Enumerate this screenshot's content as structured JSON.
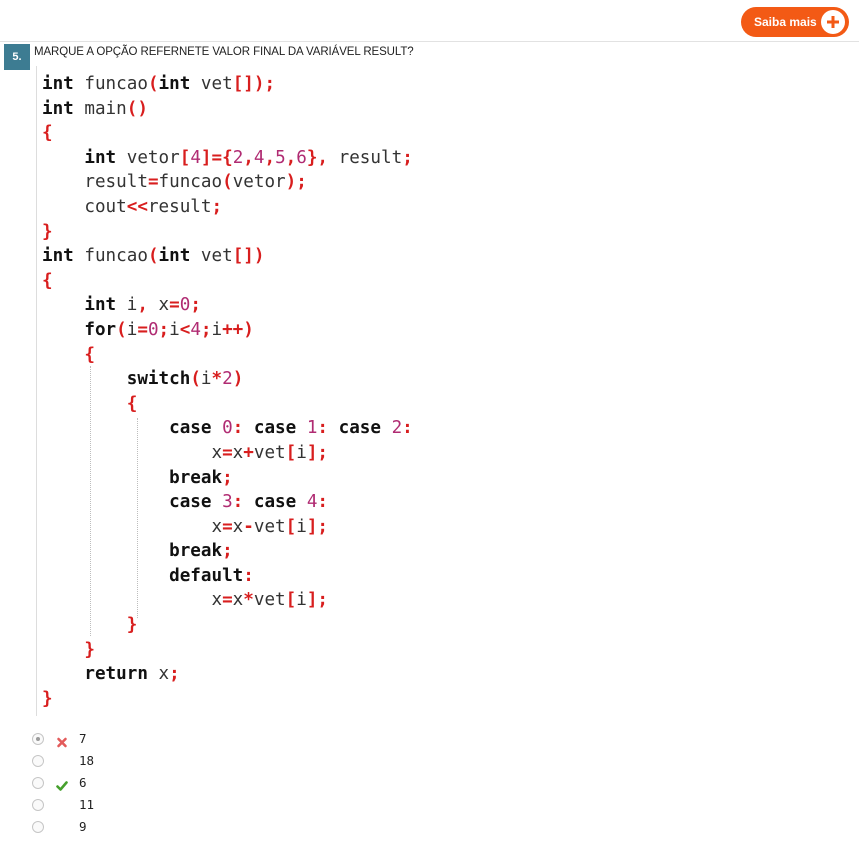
{
  "header": {
    "saiba_mais_label": "Saiba mais",
    "accent_color": "#f35a15",
    "icon": "plus-circle-icon"
  },
  "question": {
    "number": "5.",
    "text": "MARQUE A OPÇÃO REFERNETE VALOR FINAL DA VARIÁVEL RESULT?",
    "code_lines": [
      "int funcao(int vet[]);",
      "int main()",
      "{",
      "    int vetor[4]={2,4,5,6}, result;",
      "    result=funcao(vetor);",
      "    cout<<result;",
      "}",
      "int funcao(int vet[])",
      "{",
      "    int i, x=0;",
      "    for(i=0;i<4;i++)",
      "    {",
      "        switch(i*2)",
      "        {",
      "            case 0: case 1: case 2:",
      "                x=x+vet[i];",
      "            break;",
      "            case 3: case 4:",
      "                x=x-vet[i];",
      "            break;",
      "            default:",
      "                x=x*vet[i];",
      "        }",
      "    }",
      "    return x;",
      "}"
    ]
  },
  "options": [
    {
      "label": "7",
      "selected": true,
      "mark": "wrong-x-icon"
    },
    {
      "label": "18",
      "selected": false,
      "mark": ""
    },
    {
      "label": "6",
      "selected": false,
      "mark": "correct-check-icon"
    },
    {
      "label": "11",
      "selected": false,
      "mark": ""
    },
    {
      "label": "9",
      "selected": false,
      "mark": ""
    }
  ],
  "colors": {
    "question_badge": "#3d7c92",
    "operator": "#d81e1e",
    "number": "#b02b72",
    "wrong": "#e35b5b",
    "correct": "#46a02d"
  }
}
